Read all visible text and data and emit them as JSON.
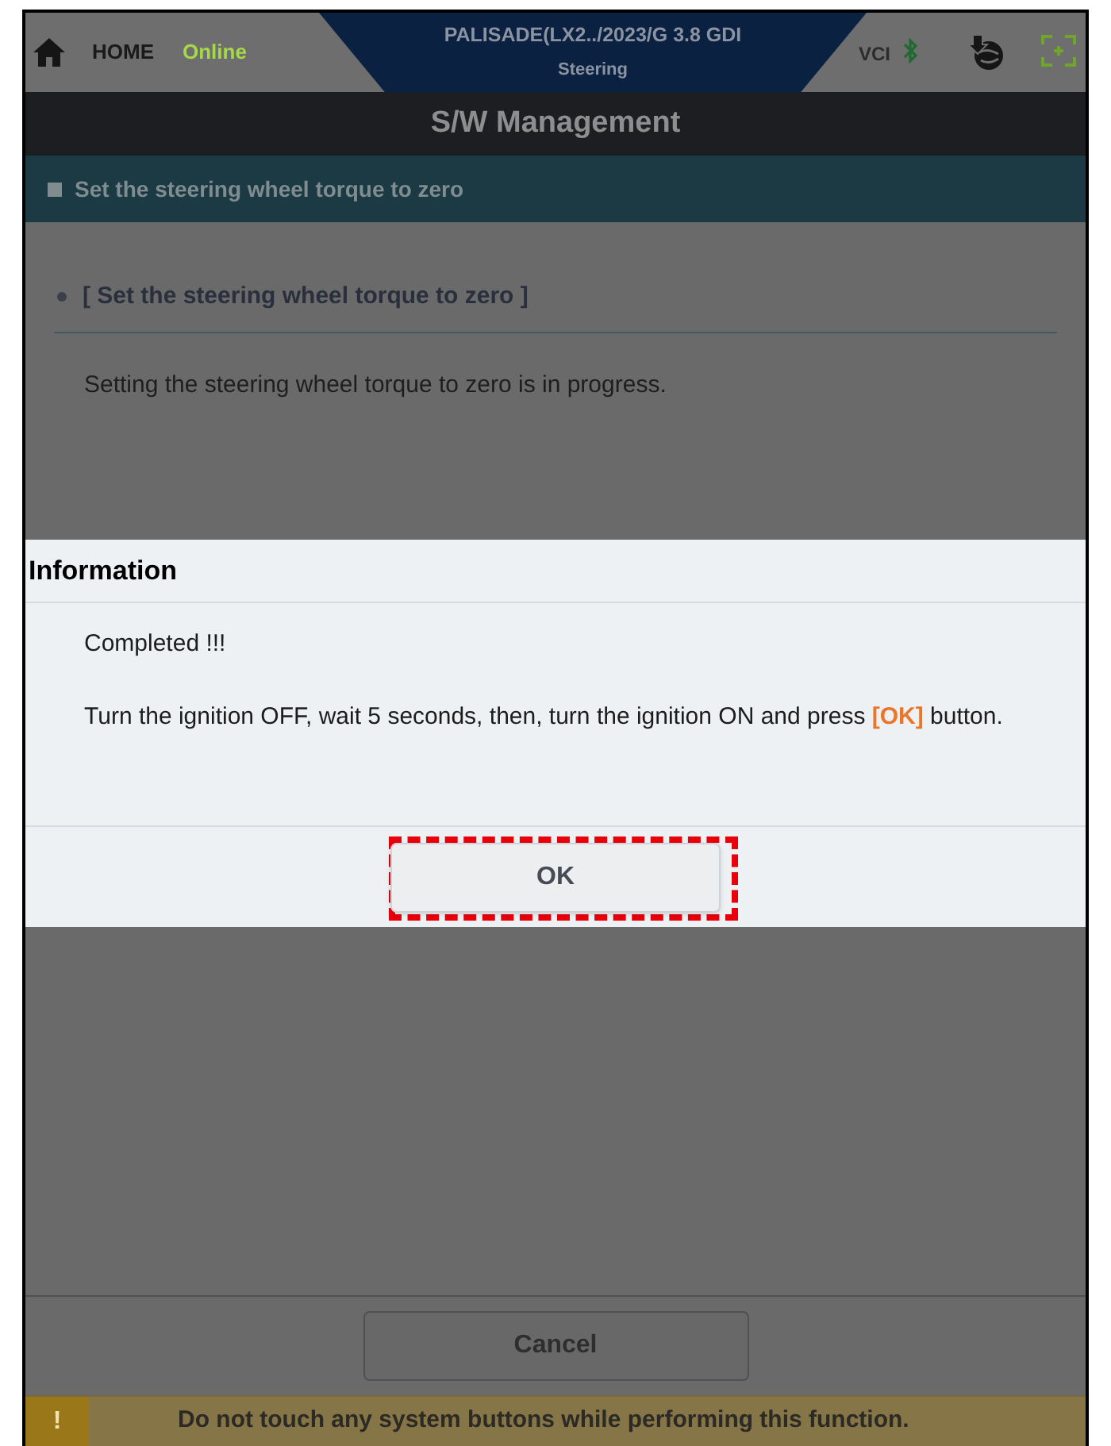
{
  "header": {
    "home_label": "HOME",
    "connection_status": "Online",
    "vehicle": "PALISADE(LX2../2023/G 3.8 GDI",
    "system": "Steering",
    "vci_label": "VCI"
  },
  "title": "S/W Management",
  "breadcrumb": "Set the steering wheel torque to zero",
  "section_heading": "[ Set the steering wheel torque to zero ]",
  "progress_text": "Setting the steering wheel torque to zero is in progress.",
  "cancel_button": "Cancel",
  "warning": {
    "icon_text": "!",
    "message": "Do not touch any system buttons while performing this function."
  },
  "dialog": {
    "title": "Information",
    "lines": [
      "Completed !!!",
      "Turn the ignition OFF, wait 5 seconds, then, turn the ignition ON and press **[OK]** button."
    ],
    "ok_button": "OK",
    "highlighted": true
  }
}
